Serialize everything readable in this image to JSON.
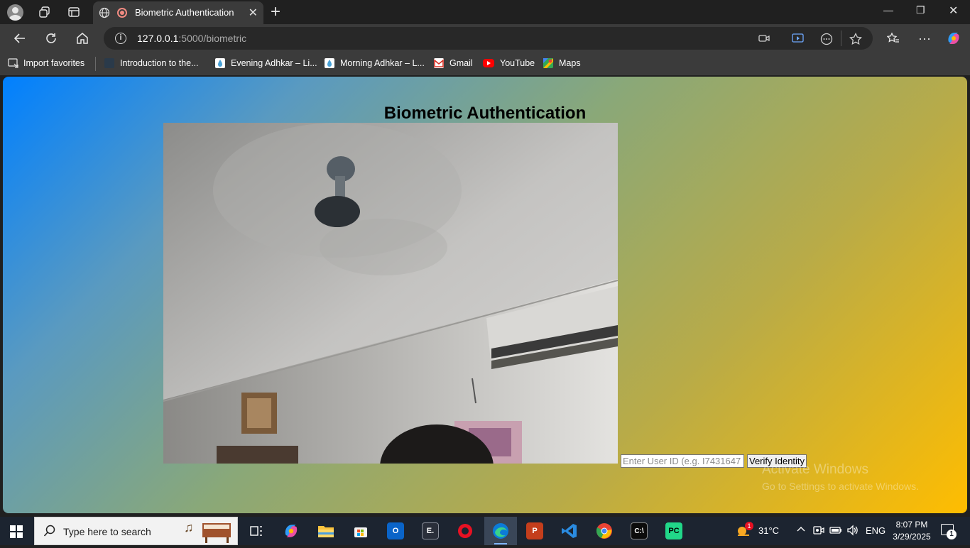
{
  "browser": {
    "tab_title": "Biometric Authentication",
    "url_host": "127.0.0.1",
    "url_rest": ":5000/biometric"
  },
  "bookmarks": [
    {
      "label": "Import favorites",
      "icon": "import-icon"
    },
    {
      "label": "Introduction to the...",
      "icon": "page-icon"
    },
    {
      "label": "Evening Adhkar – Li...",
      "icon": "drop-icon"
    },
    {
      "label": "Morning Adhkar – L...",
      "icon": "drop-icon"
    },
    {
      "label": "Gmail",
      "icon": "gmail-icon"
    },
    {
      "label": "YouTube",
      "icon": "youtube-icon"
    },
    {
      "label": "Maps",
      "icon": "maps-icon"
    }
  ],
  "page": {
    "title": "Biometric Authentication",
    "user_id_placeholder": "Enter User ID (e.g. I7431647",
    "verify_label": "Verify Identity",
    "watermark_line1": "Activate Windows",
    "watermark_line2": "Go to Settings to activate Windows."
  },
  "taskbar": {
    "search_placeholder": "Type here to search",
    "temperature": "31°C",
    "language": "ENG",
    "time": "8:07 PM",
    "date": "3/29/2025",
    "notification_count": "1",
    "weather_badge": "1"
  },
  "colors": {
    "gradient_start": "#0080ff",
    "gradient_end": "#ffbd00",
    "browser_dark": "#202020",
    "toolbar": "#3b3b3b"
  }
}
